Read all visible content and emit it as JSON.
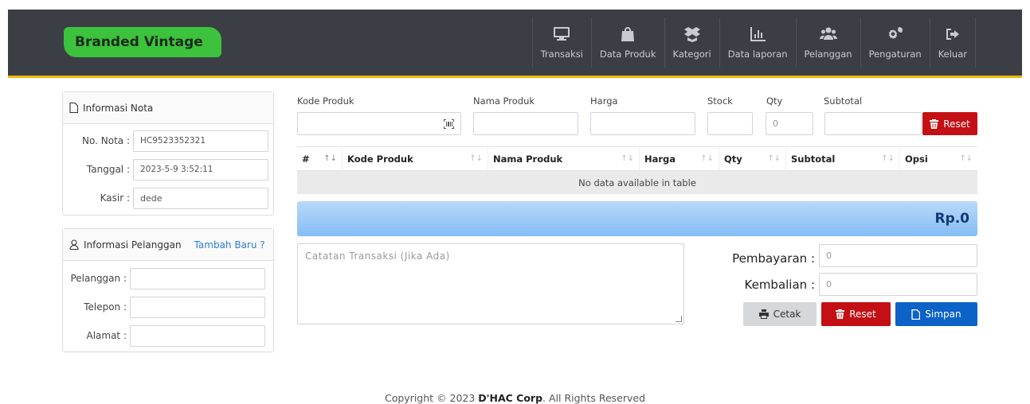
{
  "brand": "Branded Vintage",
  "nav": {
    "items": [
      {
        "label": "Transaksi",
        "icon": "monitor-icon"
      },
      {
        "label": "Data Produk",
        "icon": "shopping-bag-icon"
      },
      {
        "label": "Kategori",
        "icon": "box-open-icon"
      },
      {
        "label": "Data laporan",
        "icon": "bar-chart-icon"
      },
      {
        "label": "Pelanggan",
        "icon": "users-icon"
      },
      {
        "label": "Pengaturan",
        "icon": "cogs-icon"
      },
      {
        "label": "Keluar",
        "icon": "sign-out-icon"
      }
    ]
  },
  "nota": {
    "title": "Informasi Nota",
    "no_label": "No. Nota :",
    "no_value": "HC9523352321",
    "tanggal_label": "Tanggal :",
    "tanggal_value": "2023-5-9 3:52:11",
    "kasir_label": "Kasir :",
    "kasir_value": "dede"
  },
  "pelanggan": {
    "title": "Informasi Pelanggan",
    "add_link": "Tambah Baru ?",
    "pelanggan_label": "Pelanggan :",
    "telepon_label": "Telepon :",
    "alamat_label": "Alamat :"
  },
  "form": {
    "kode_label": "Kode Produk",
    "nama_label": "Nama Produk",
    "harga_label": "Harga",
    "stock_label": "Stock",
    "qty_label": "Qty",
    "qty_value": "0",
    "subtotal_label": "Subtotal",
    "reset_label": "Reset"
  },
  "table": {
    "columns": [
      "#",
      "Kode Produk",
      "Nama Produk",
      "Harga",
      "Qty",
      "Subtotal",
      "Opsi"
    ],
    "empty_text": "No data available in table"
  },
  "total": "Rp.0",
  "note_placeholder": "Catatan Transaksi (Jika Ada)",
  "payment": {
    "pembayaran_label": "Pembayaran :",
    "pembayaran_value": "0",
    "kembalian_label": "Kembalian :",
    "kembalian_value": "0",
    "cetak_label": "Cetak",
    "reset_label": "Reset",
    "simpan_label": "Simpan"
  },
  "footer": {
    "prefix": "Copyright © 2023 ",
    "company": "D'HAC Corp",
    "suffix": ". All Rights Reserved"
  },
  "colors": {
    "navbar": "#3b3f45",
    "accent": "#f2b705",
    "brand_bg": "#3cc23c",
    "danger": "#c41014",
    "primary": "#0c62c6",
    "link": "#2a7fd4"
  }
}
